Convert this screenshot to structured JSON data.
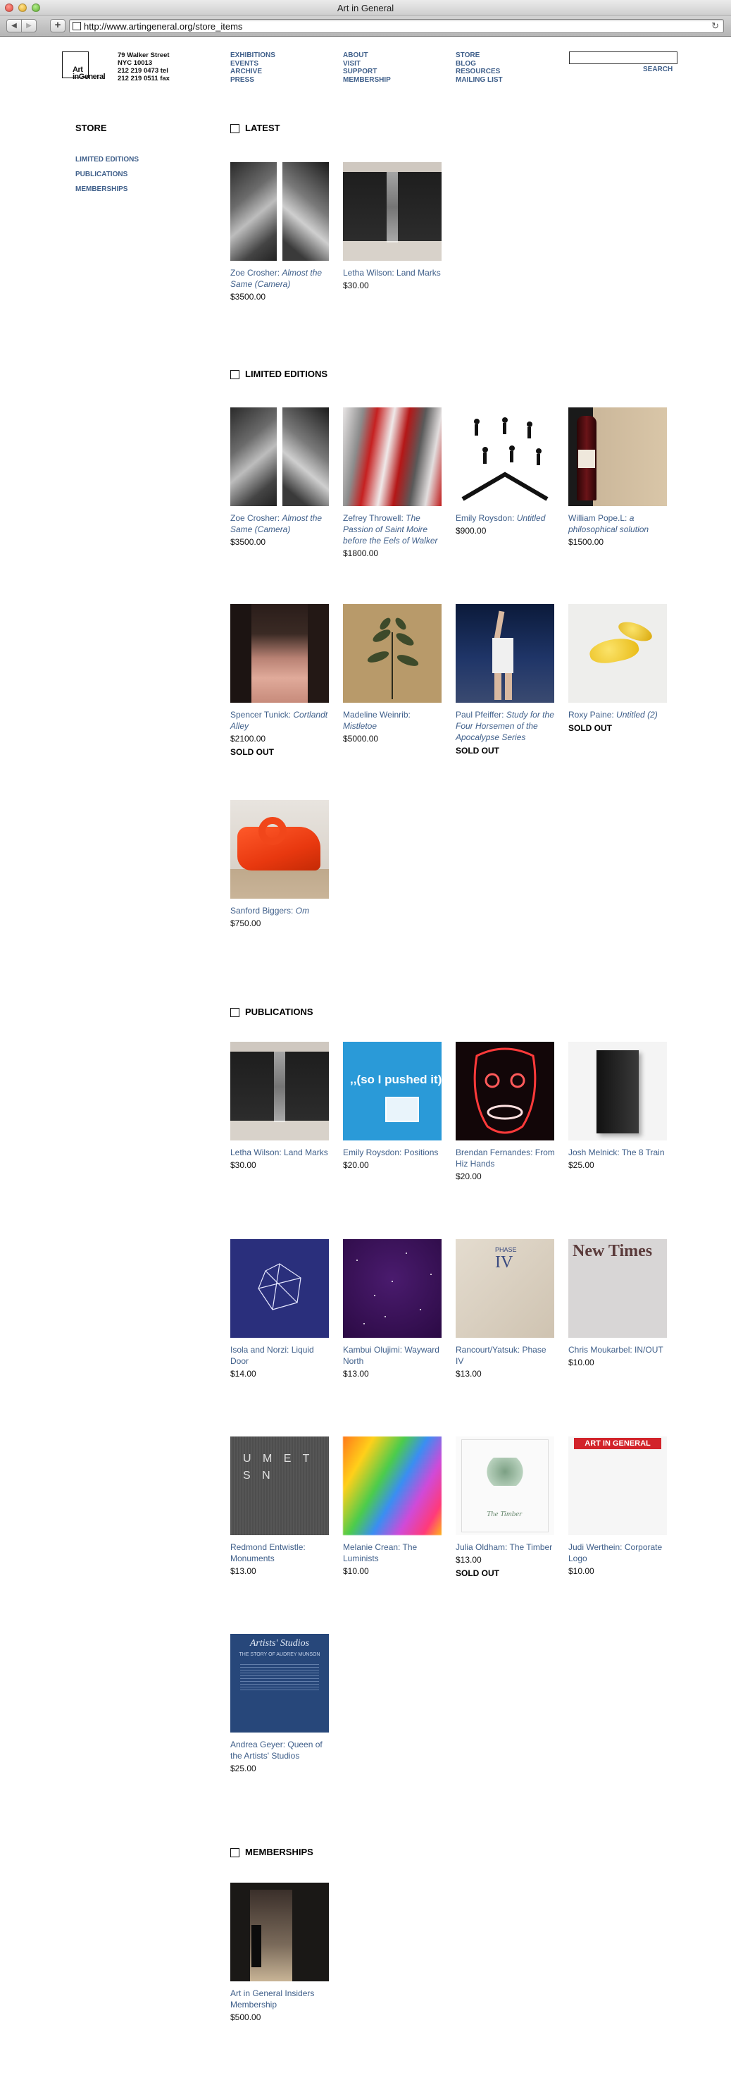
{
  "browser": {
    "window_title": "Art in General",
    "url": "http://www.artingeneral.org/store_items",
    "back": "◀",
    "forward": "▶",
    "add": "+",
    "reload": "↻"
  },
  "header": {
    "logo_line1": "Art",
    "logo_line2": "inGeneral",
    "address": [
      "79 Walker Street",
      "NYC 10013",
      "212 219 0473 tel",
      "212 219 0511 fax"
    ],
    "nav": [
      [
        "EXHIBITIONS",
        "EVENTS",
        "ARCHIVE",
        "PRESS"
      ],
      [
        "ABOUT",
        "VISIT",
        "SUPPORT",
        "MEMBERSHIP"
      ],
      [
        "STORE",
        "BLOG",
        "RESOURCES",
        "MAILING LIST"
      ]
    ],
    "search_value": "",
    "search_label": "SEARCH"
  },
  "sidebar": {
    "title": "STORE",
    "links": [
      "LIMITED EDITIONS",
      "PUBLICATIONS",
      "MEMBERSHIPS"
    ]
  },
  "sections": [
    {
      "title": "LATEST"
    },
    {
      "title": "LIMITED EDITIONS"
    },
    {
      "title": "PUBLICATIONS"
    },
    {
      "title": "MEMBERSHIPS"
    }
  ],
  "items": [
    {
      "section": "LATEST",
      "artist": "Zoe Crosher:",
      "work": "Almost the Same (Camera)",
      "price": "$3500.00",
      "status": "",
      "image": "photo-diptych"
    },
    {
      "section": "LATEST",
      "artist": "Letha Wilson: Land Marks",
      "work": "",
      "price": "$30.00",
      "status": "",
      "image": "book-dark"
    },
    {
      "section": "LIMITED EDITIONS",
      "artist": "Zoe Crosher:",
      "work": "Almost the Same (Camera)",
      "price": "$3500.00",
      "status": "",
      "image": "photo-diptych"
    },
    {
      "section": "LIMITED EDITIONS",
      "artist": "Zefrey Throwell:",
      "work": "The Passion of Saint Moire before the Eels of Walker",
      "price": "$1800.00",
      "status": "",
      "image": "red-painting"
    },
    {
      "section": "LIMITED EDITIONS",
      "artist": "Emily Roysdon:",
      "work": "Untitled",
      "price": "$900.00",
      "status": "",
      "image": "figures"
    },
    {
      "section": "LIMITED EDITIONS",
      "artist": "William Pope.L:",
      "work": "a philosophical solution",
      "price": "$1500.00",
      "status": "",
      "image": "wine-bottle"
    },
    {
      "section": "LIMITED EDITIONS",
      "artist": "Spencer Tunick:",
      "work": "Cortlandt Alley",
      "price": "$2100.00",
      "status": "SOLD OUT",
      "image": "alley"
    },
    {
      "section": "LIMITED EDITIONS",
      "artist": "Madeline Weinrib:",
      "work": "Mistletoe",
      "price": "$5000.00",
      "status": "",
      "image": "mistletoe"
    },
    {
      "section": "LIMITED EDITIONS",
      "artist": "Paul Pfeiffer:",
      "work": "Study for the Four Horsemen of the Apocalypse Series",
      "price": "",
      "status": "SOLD OUT",
      "image": "basketball"
    },
    {
      "section": "LIMITED EDITIONS",
      "artist": "Roxy Paine:",
      "work": "Untitled (2)",
      "price": "",
      "status": "SOLD OUT",
      "image": "yellow-shape"
    },
    {
      "section": "LIMITED EDITIONS",
      "artist": "Sanford Biggers:",
      "work": "Om",
      "price": "$750.00",
      "status": "",
      "image": "red-sculpture"
    },
    {
      "section": "PUBLICATIONS",
      "artist": "Letha Wilson: Land Marks",
      "work": "",
      "price": "$30.00",
      "status": "",
      "image": "book-dark"
    },
    {
      "section": "PUBLICATIONS",
      "artist": "Emily Roysdon: Positions",
      "work": "",
      "price": "$20.00",
      "status": "",
      "image": "blue-book"
    },
    {
      "section": "PUBLICATIONS",
      "artist": "Brendan Fernandes: From Hiz Hands",
      "work": "",
      "price": "$20.00",
      "status": "",
      "image": "neon-face"
    },
    {
      "section": "PUBLICATIONS",
      "artist": "Josh Melnick: The 8 Train",
      "work": "",
      "price": "$25.00",
      "status": "",
      "image": "black-book"
    },
    {
      "section": "PUBLICATIONS",
      "artist": "Isola and Norzi: Liquid Door",
      "work": "",
      "price": "$14.00",
      "status": "",
      "image": "navy-polyhedron"
    },
    {
      "section": "PUBLICATIONS",
      "artist": "Kambui Olujimi: Wayward North",
      "work": "",
      "price": "$13.00",
      "status": "",
      "image": "purple-stars"
    },
    {
      "section": "PUBLICATIONS",
      "artist": "Rancourt/Yatsuk: Phase IV",
      "work": "",
      "price": "$13.00",
      "status": "",
      "image": "phase-iv"
    },
    {
      "section": "PUBLICATIONS",
      "artist": "Chris Moukarbel: IN/OUT",
      "work": "",
      "price": "$10.00",
      "status": "",
      "image": "new-times"
    },
    {
      "section": "PUBLICATIONS",
      "artist": "Redmond Entwistle: Monuments",
      "work": "",
      "price": "$13.00",
      "status": "",
      "image": "monuments"
    },
    {
      "section": "PUBLICATIONS",
      "artist": "Melanie Crean: The Luminists",
      "work": "",
      "price": "$10.00",
      "status": "",
      "image": "colors"
    },
    {
      "section": "PUBLICATIONS",
      "artist": "Julia Oldham: The Timber",
      "work": "",
      "price": "$13.00",
      "status": "SOLD OUT",
      "image": "timber"
    },
    {
      "section": "PUBLICATIONS",
      "artist": "Judi Werthein: Corporate Logo",
      "work": "",
      "price": "$10.00",
      "status": "",
      "image": "aig-logo"
    },
    {
      "section": "PUBLICATIONS",
      "artist": "Andrea Geyer: Queen of the Artists' Studios",
      "work": "",
      "price": "$25.00",
      "status": "",
      "image": "blue-cover"
    },
    {
      "section": "MEMBERSHIPS",
      "artist": "Art in General Insiders Membership",
      "work": "",
      "price": "$500.00",
      "status": "",
      "image": "doorway"
    }
  ],
  "thumb_text": {
    "blue_book": ",,(so I pushed it)",
    "phase_small": "PHASE",
    "phase_big": "IV",
    "new_times": "New Times",
    "monuments": "U M E T S N",
    "timber": "The Timber",
    "aig": "ART IN GENERAL",
    "queen_title": "Artists' Studios",
    "queen_sub": "THE STORY OF AUDREY MUNSON"
  }
}
